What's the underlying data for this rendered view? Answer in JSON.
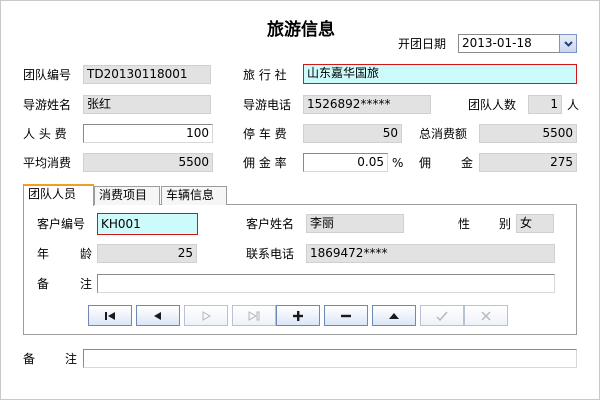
{
  "window": {
    "title": "旅游信息"
  },
  "header": {
    "start_date_label": "开团日期",
    "start_date_value": "2013-01-18"
  },
  "form": {
    "team_no_label": "团队编号",
    "team_no": "TD20130118001",
    "agency_label": "旅 行 社",
    "agency": "山东嘉华国旅",
    "guide_name_label": "导游姓名",
    "guide_name": "张红",
    "guide_phone_label": "导游电话",
    "guide_phone": "1526892*****",
    "team_size_label": "团队人数",
    "team_size": "1",
    "team_size_unit": "人",
    "per_head_fee_label": "人 头 费",
    "per_head_fee": "100",
    "parking_fee_label": "停 车 费",
    "parking_fee": "50",
    "total_spend_label": "总消费额",
    "total_spend": "5500",
    "avg_spend_label": "平均消费",
    "avg_spend": "5500",
    "commission_rate_label": "佣 金 率",
    "commission_rate": "0.05",
    "commission_rate_unit": "%",
    "commission_label_a": "佣",
    "commission_label_b": "金",
    "commission": "275"
  },
  "tabs": [
    {
      "label": "团队人员"
    },
    {
      "label": "消费项目"
    },
    {
      "label": "车辆信息"
    }
  ],
  "member": {
    "customer_no_label": "客户编号",
    "customer_no": "KH001",
    "customer_name_label": "客户姓名",
    "customer_name": "李丽",
    "gender_label_a": "性",
    "gender_label_b": "别",
    "gender": "女",
    "age_label_a": "年",
    "age_label_b": "龄",
    "age": "25",
    "phone_label": "联系电话",
    "phone": "1869472****",
    "remark_label_a": "备",
    "remark_label_b": "注",
    "remark": ""
  },
  "navigator": {
    "buttons": [
      {
        "icon": "first-record-icon",
        "enabled": true
      },
      {
        "icon": "prior-record-icon",
        "enabled": true
      },
      {
        "icon": "next-record-icon",
        "enabled": false
      },
      {
        "icon": "last-record-icon",
        "enabled": false
      },
      {
        "icon": "insert-record-icon",
        "enabled": true
      },
      {
        "icon": "delete-record-icon",
        "enabled": true
      },
      {
        "icon": "edit-record-icon",
        "enabled": true
      },
      {
        "icon": "post-edit-icon",
        "enabled": false
      },
      {
        "icon": "cancel-edit-icon",
        "enabled": false
      }
    ]
  },
  "footer": {
    "remark_label_a": "备",
    "remark_label_b": "注",
    "remark": ""
  }
}
